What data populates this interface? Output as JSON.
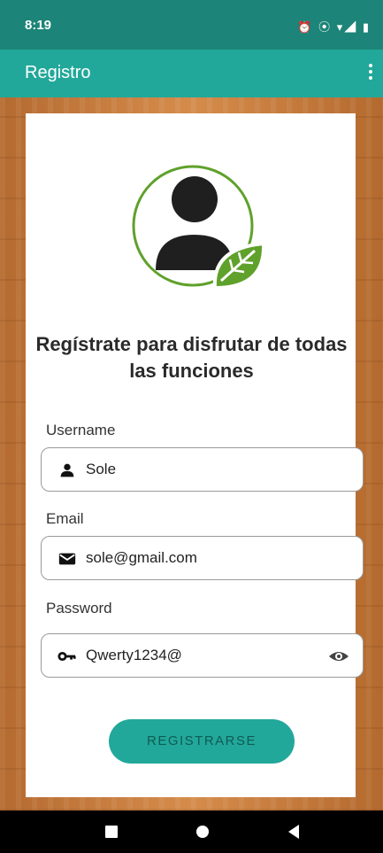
{
  "status_bar": {
    "time": "8:19",
    "icons": "⏰ ⦿ ▾◢ ▮"
  },
  "app_bar": {
    "title": "Registro"
  },
  "headline": "Regístrate para disfrutar de todas las funciones",
  "fields": {
    "username": {
      "label": "Username",
      "value": "Sole",
      "icon": "person-icon"
    },
    "email": {
      "label": "Email",
      "value": "sole@gmail.com",
      "icon": "mail-icon"
    },
    "password": {
      "label": "Password",
      "value": "Qwerty1234@",
      "icon": "key-icon"
    }
  },
  "submit_label": "REGISTRARSE",
  "colors": {
    "primary": "#22a89a",
    "primary_dark": "#1c8478",
    "leaf": "#5fa12b"
  },
  "nav": {
    "icons": [
      "recents-icon",
      "home-icon",
      "back-icon"
    ]
  }
}
